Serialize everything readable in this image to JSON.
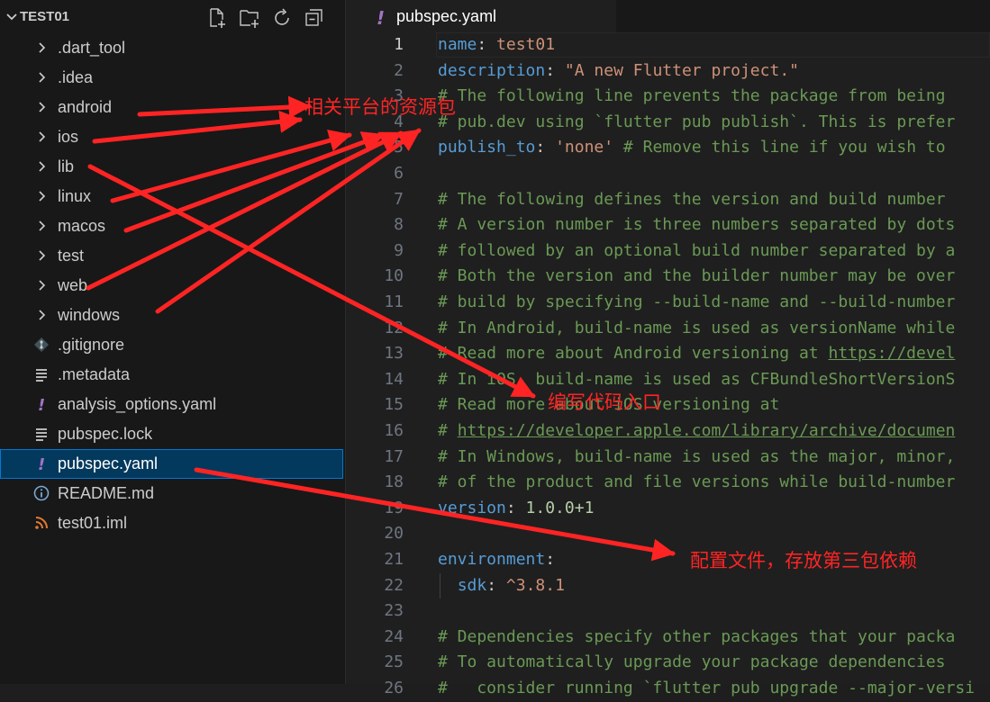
{
  "sidebar": {
    "folder_name": "TEST01",
    "header_icons": [
      "new-file-icon",
      "new-folder-icon",
      "refresh-icon",
      "collapse-all-icon"
    ],
    "items": [
      {
        "label": ".dart_tool",
        "kind": "folder",
        "icon": "chevron-right-icon"
      },
      {
        "label": ".idea",
        "kind": "folder",
        "icon": "chevron-right-icon"
      },
      {
        "label": "android",
        "kind": "folder",
        "icon": "chevron-right-icon"
      },
      {
        "label": "ios",
        "kind": "folder",
        "icon": "chevron-right-icon"
      },
      {
        "label": "lib",
        "kind": "folder",
        "icon": "chevron-right-icon"
      },
      {
        "label": "linux",
        "kind": "folder",
        "icon": "chevron-right-icon"
      },
      {
        "label": "macos",
        "kind": "folder",
        "icon": "chevron-right-icon"
      },
      {
        "label": "test",
        "kind": "folder",
        "icon": "chevron-right-icon"
      },
      {
        "label": "web",
        "kind": "folder",
        "icon": "chevron-right-icon"
      },
      {
        "label": "windows",
        "kind": "folder",
        "icon": "chevron-right-icon"
      },
      {
        "label": ".gitignore",
        "kind": "file",
        "icon": "git-icon"
      },
      {
        "label": ".metadata",
        "kind": "file",
        "icon": "lines-icon"
      },
      {
        "label": "analysis_options.yaml",
        "kind": "file",
        "icon": "yaml-icon"
      },
      {
        "label": "pubspec.lock",
        "kind": "file",
        "icon": "lines-icon"
      },
      {
        "label": "pubspec.yaml",
        "kind": "file",
        "icon": "yaml-icon",
        "selected": true
      },
      {
        "label": "README.md",
        "kind": "file",
        "icon": "info-icon"
      },
      {
        "label": "test01.iml",
        "kind": "file",
        "icon": "rss-icon"
      }
    ]
  },
  "editor": {
    "tab": {
      "label": "pubspec.yaml",
      "icon": "yaml-icon"
    },
    "active_line": 1,
    "lines": [
      [
        {
          "t": "name",
          "c": "k"
        },
        {
          "t": ": ",
          "c": "p"
        },
        {
          "t": "test01",
          "c": "s"
        }
      ],
      [
        {
          "t": "description",
          "c": "k"
        },
        {
          "t": ": ",
          "c": "p"
        },
        {
          "t": "\"A new Flutter project.\"",
          "c": "s"
        }
      ],
      [
        {
          "t": "# The following line prevents the package from being",
          "c": "c"
        }
      ],
      [
        {
          "t": "# pub.dev using `flutter pub publish`. This is prefer",
          "c": "c"
        }
      ],
      [
        {
          "t": "publish_to",
          "c": "k"
        },
        {
          "t": ": ",
          "c": "p"
        },
        {
          "t": "'none'",
          "c": "s"
        },
        {
          "t": " # Remove this line if you wish to",
          "c": "c"
        }
      ],
      [],
      [
        {
          "t": "# The following defines the version and build number",
          "c": "c"
        }
      ],
      [
        {
          "t": "# A version number is three numbers separated by dots",
          "c": "c"
        }
      ],
      [
        {
          "t": "# followed by an optional build number separated by a",
          "c": "c"
        }
      ],
      [
        {
          "t": "# Both the version and the builder number may be over",
          "c": "c"
        }
      ],
      [
        {
          "t": "# build by specifying --build-name and --build-number",
          "c": "c"
        }
      ],
      [
        {
          "t": "# In Android, build-name is used as versionName while",
          "c": "c"
        }
      ],
      [
        {
          "t": "# Read more about Android versioning at ",
          "c": "c"
        },
        {
          "t": "https://devel",
          "c": "u"
        }
      ],
      [
        {
          "t": "# In iOS, build-name is used as CFBundleShortVersionS",
          "c": "c"
        }
      ],
      [
        {
          "t": "# Read more about iOS versioning at",
          "c": "c"
        }
      ],
      [
        {
          "t": "# ",
          "c": "c"
        },
        {
          "t": "https://developer.apple.com/library/archive/documen",
          "c": "u"
        }
      ],
      [
        {
          "t": "# In Windows, build-name is used as the major, minor,",
          "c": "c"
        }
      ],
      [
        {
          "t": "# of the product and file versions while build-number",
          "c": "c"
        }
      ],
      [
        {
          "t": "version",
          "c": "k"
        },
        {
          "t": ": ",
          "c": "p"
        },
        {
          "t": "1.0.0+1",
          "c": "n"
        }
      ],
      [],
      [
        {
          "t": "environment",
          "c": "k"
        },
        {
          "t": ":",
          "c": "p"
        }
      ],
      [
        {
          "t": "  ",
          "c": "p"
        },
        {
          "t": "sdk",
          "c": "k"
        },
        {
          "t": ": ",
          "c": "p"
        },
        {
          "t": "^3.8.1",
          "c": "s"
        }
      ],
      [],
      [
        {
          "t": "# Dependencies specify other packages that your packa",
          "c": "c"
        }
      ],
      [
        {
          "t": "# To automatically upgrade your package dependencies ",
          "c": "c"
        }
      ],
      [
        {
          "t": "#   consider running `flutter pub upgrade --major-versi",
          "c": "c"
        }
      ]
    ]
  },
  "annotations": {
    "color": "#ff2424",
    "platform_label": "相关平台的资源包",
    "lib_label": "编写代码入口",
    "pubspec_label": "配置文件，存放第三包依赖"
  }
}
